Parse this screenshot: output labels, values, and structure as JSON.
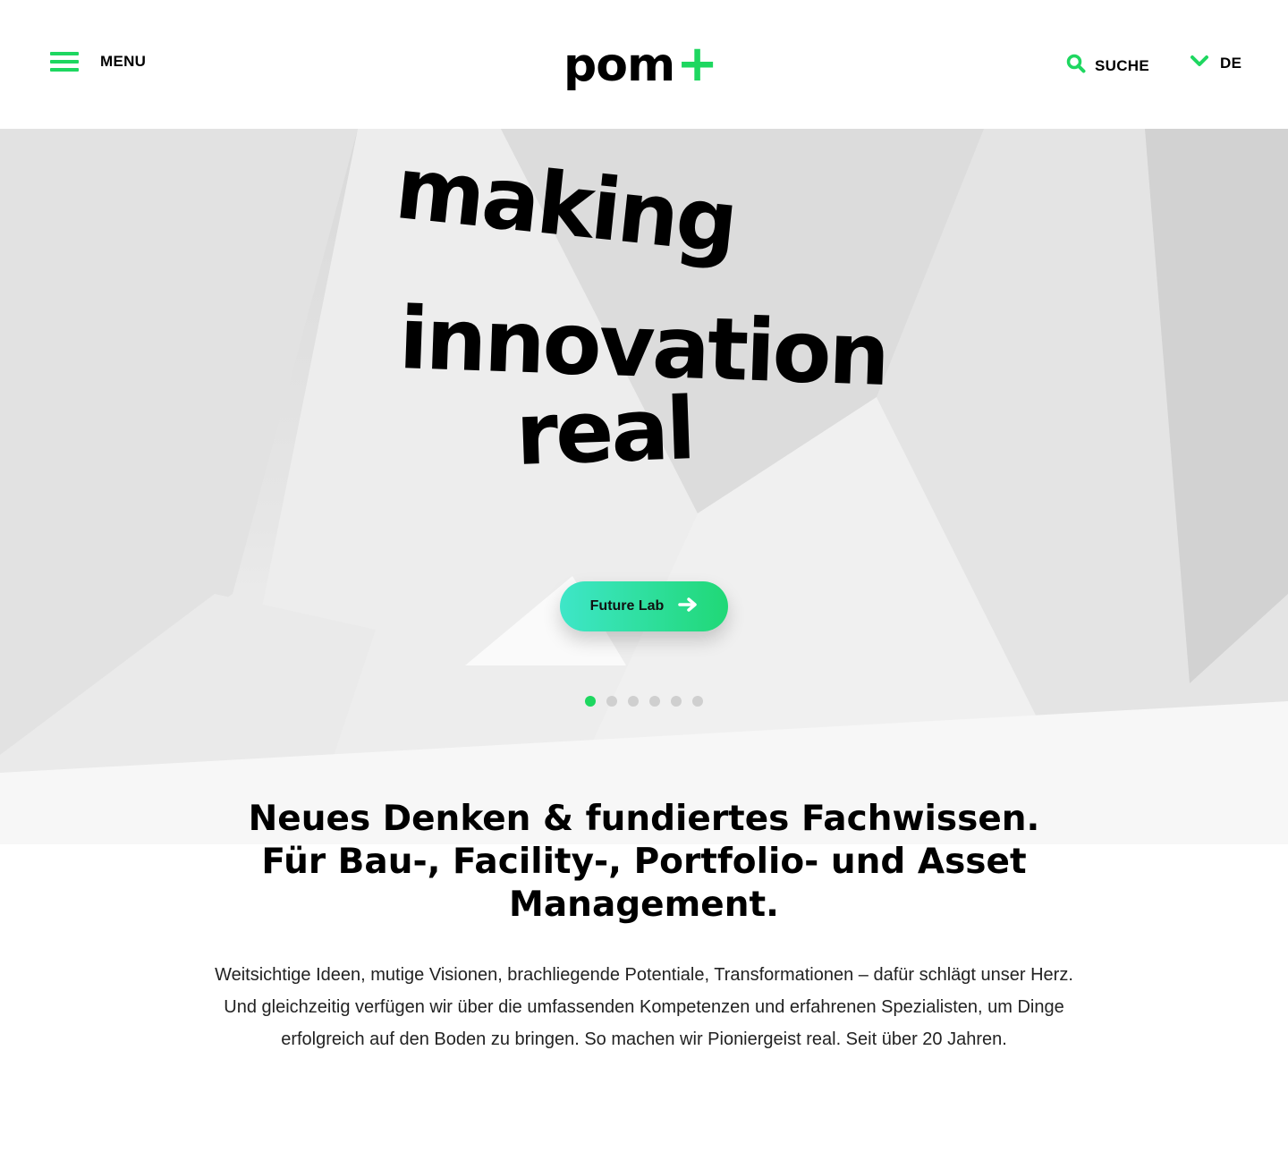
{
  "header": {
    "menu_label": "MENU",
    "logo_text": "pom",
    "logo_plus": "+",
    "search_label": "SUCHE",
    "language_label": "DE"
  },
  "hero": {
    "line1": "making",
    "line2": "innovation",
    "line3": "real",
    "cta_label": "Future Lab",
    "slides_total": 6,
    "active_slide": 1
  },
  "intro": {
    "headline_line1": "Neues Denken & fundiertes Fachwissen.",
    "headline_line2": "Für Bau-, Facility-, Portfolio- und Asset",
    "headline_line3": "Management.",
    "body_line1": "Weitsichtige Ideen, mutige Visionen, brachliegende Potentiale, Transformationen – dafür schlägt unser Herz.",
    "body_line2": "Und gleichzeitig verfügen wir über die umfassenden Kompetenzen und erfahrenen Spezialisten, um Dinge",
    "body_line3": "erfolgreich auf den Boden zu bringen. So machen wir Pioniergeist real. Seit über 20 Jahren."
  },
  "colors": {
    "accent": "#1ed760",
    "cta_gradient_start": "#3ee6c8",
    "cta_gradient_end": "#20d876",
    "text": "#000000"
  },
  "icons": {
    "menu": "hamburger-icon",
    "search": "search-icon",
    "language": "chevron-down-icon",
    "cta": "arrow-right-icon"
  }
}
